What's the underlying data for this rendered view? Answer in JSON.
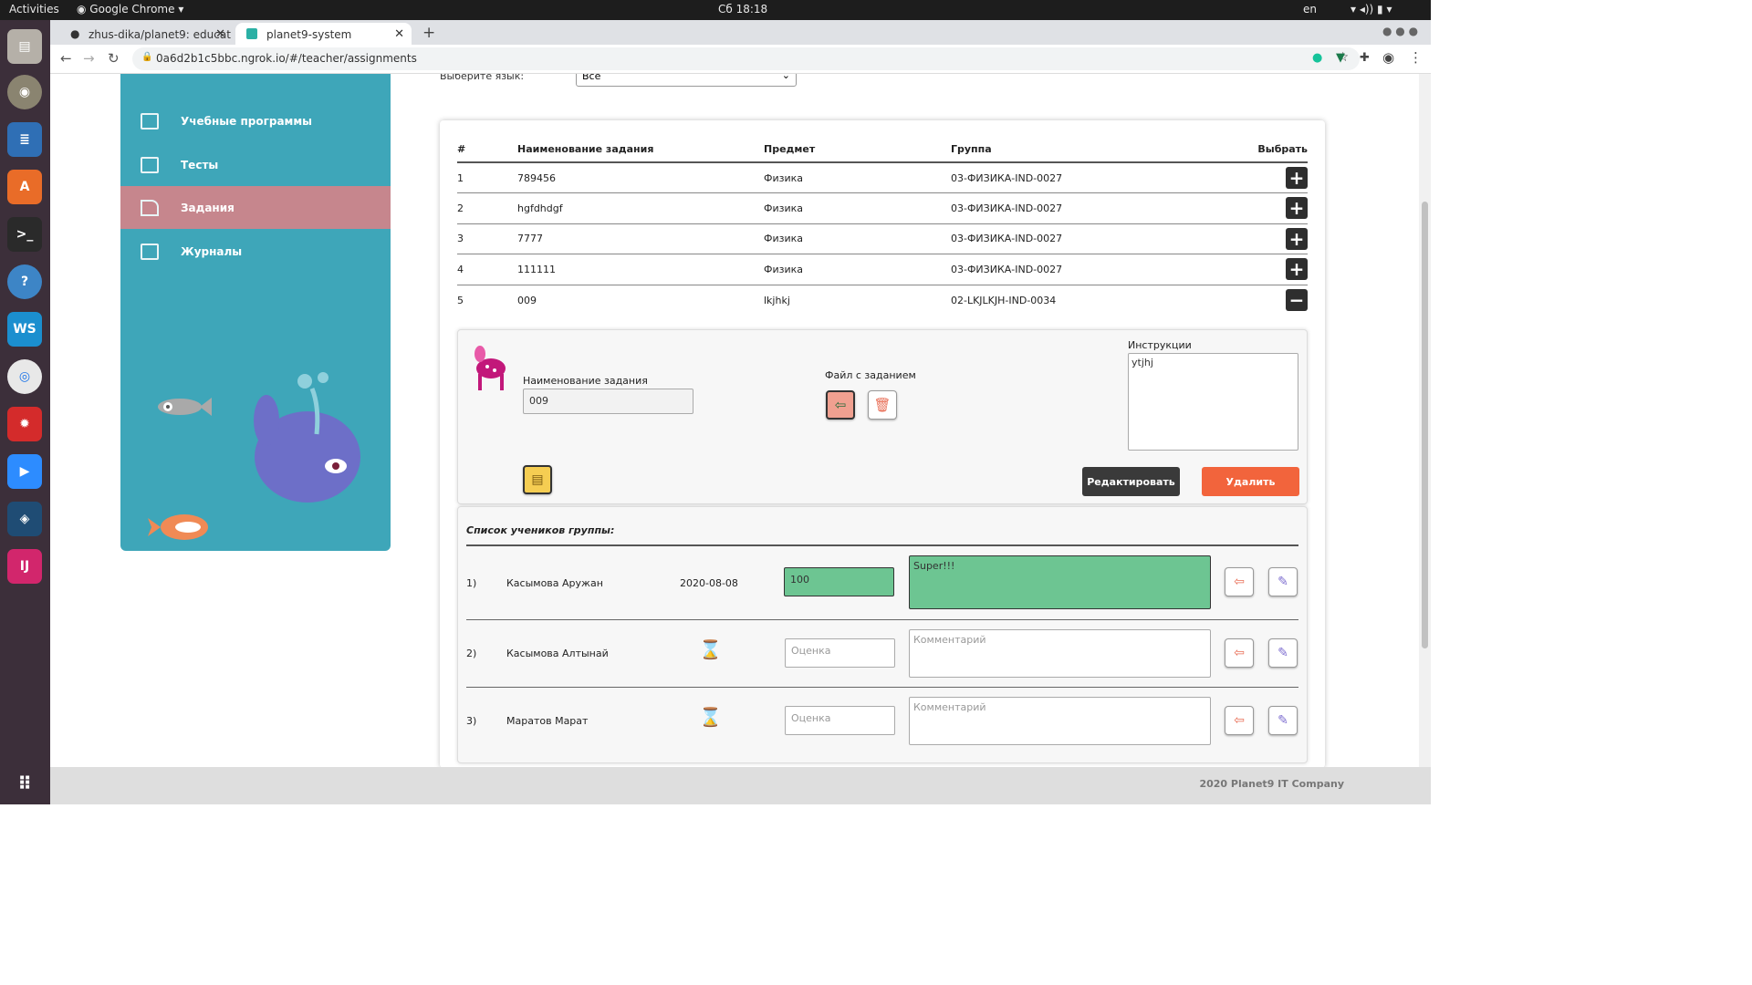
{
  "os_bar": {
    "activities": "Activities",
    "app": "Google Chrome",
    "clock": "Сб 18:18",
    "lang": "en"
  },
  "browser": {
    "tabs": [
      {
        "label": "zhus-dika/planet9: educat",
        "active": false
      },
      {
        "label": "planet9-system",
        "active": true
      }
    ],
    "url": "0a6d2b1c5bbc.ngrok.io/#/teacher/assignments"
  },
  "sidebar": {
    "items": [
      {
        "label": "Учебные программы",
        "icon": "curriculum-icon"
      },
      {
        "label": "Тесты",
        "icon": "tests-icon"
      },
      {
        "label": "Задания",
        "icon": "assignments-icon",
        "active": true
      },
      {
        "label": "Журналы",
        "icon": "journals-icon"
      }
    ]
  },
  "lang_filter": {
    "label": "Выберите язык:",
    "value": "Все"
  },
  "table": {
    "headers": [
      "#",
      "Наименование задания",
      "Предмет",
      "Группа",
      "Выбрать"
    ],
    "rows": [
      {
        "n": "1",
        "name": "789456",
        "subject": "Физика",
        "group": "03-ФИЗИКА-IND-0027",
        "action": "+"
      },
      {
        "n": "2",
        "name": "hgfdhdgf",
        "subject": "Физика",
        "group": "03-ФИЗИКА-IND-0027",
        "action": "+"
      },
      {
        "n": "3",
        "name": "7777",
        "subject": "Физика",
        "group": "03-ФИЗИКА-IND-0027",
        "action": "+"
      },
      {
        "n": "4",
        "name": "111111",
        "subject": "Физика",
        "group": "03-ФИЗИКА-IND-0027",
        "action": "+"
      },
      {
        "n": "5",
        "name": "009",
        "subject": "lkjhkj",
        "group": "02-LKJLKJH-IND-0034",
        "action": "−"
      }
    ]
  },
  "detail": {
    "name_label": "Наименование задания",
    "name_value": "009",
    "file_label": "Файл с заданием",
    "instructions_label": "Инструкции",
    "instructions_value": "ytjhj",
    "edit_button": "Редактировать",
    "delete_button": "Удалить"
  },
  "students": {
    "title": "Список учеников группы:",
    "grade_placeholder": "Оценка",
    "comment_placeholder": "Комментарий",
    "rows": [
      {
        "n": "1)",
        "name": "Касымова Аружан",
        "date": "2020-08-08",
        "grade": "100",
        "comment": "Super!!!",
        "submitted": true
      },
      {
        "n": "2)",
        "name": "Касымова Алтынай",
        "date": "",
        "grade": "",
        "comment": "",
        "submitted": false
      },
      {
        "n": "3)",
        "name": "Маратов Марат",
        "date": "",
        "grade": "",
        "comment": "",
        "submitted": false
      }
    ]
  },
  "footer": {
    "text": "2020 Planet9 IT Company"
  },
  "colors": {
    "sidebar": "#3ea6b9",
    "active_item": "#c6868d",
    "delete": "#f2643c",
    "edit": "#3a3a3a",
    "graded": "#6dc592"
  }
}
